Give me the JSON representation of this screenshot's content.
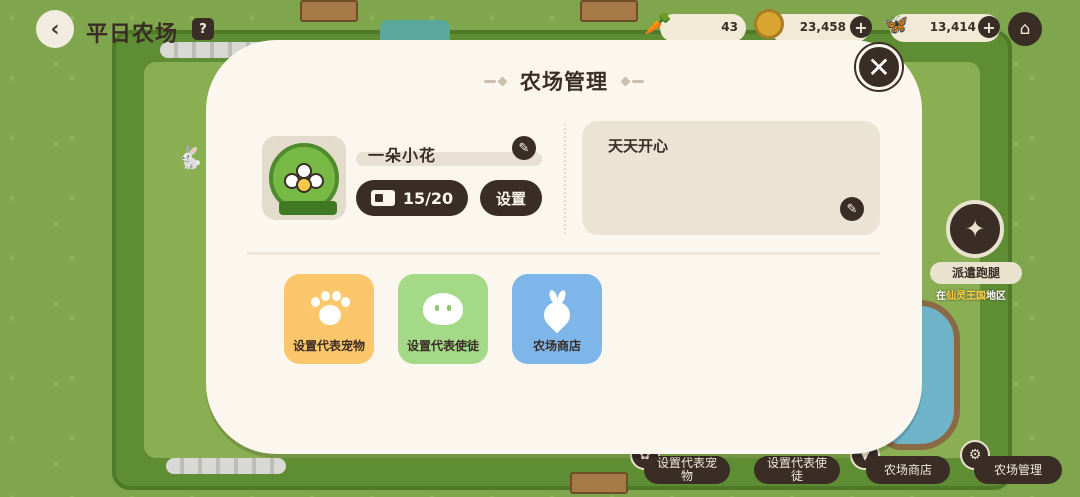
{
  "header": {
    "back_icon": "back-arrow-icon",
    "farm_title": "平日农场",
    "info_icon": "book-icon"
  },
  "resources": [
    {
      "icon": "carrot-icon",
      "value": "43"
    },
    {
      "icon": "coin-icon",
      "value": "23,458"
    },
    {
      "icon": "butterfly-icon",
      "value": "13,414"
    }
  ],
  "dispatch": {
    "label": "派遣跑腿",
    "location_prefix": "在",
    "location_name": "仙灵王国",
    "location_suffix": "地区"
  },
  "dock": {
    "pet": "设置代表宠物",
    "envoy": "设置代表使徒",
    "shop": "农场商店",
    "manage": "农场管理"
  },
  "modal": {
    "title": "农场管理",
    "close_icon": "close-icon",
    "farm_name": "一朵小花",
    "count": "15/20",
    "settings_label": "设置",
    "motto": "天天开心",
    "tiles": [
      {
        "label": "设置代表宠物",
        "color": "#fcc66a",
        "icon": "paw-icon"
      },
      {
        "label": "设置代表使徒",
        "color": "#a3d987",
        "icon": "sprite-icon"
      },
      {
        "label": "农场商店",
        "color": "#7fb6ea",
        "icon": "carrot-icon"
      }
    ]
  },
  "colors": {
    "dark_brown": "#3a2d25",
    "cream": "#fbf6ee",
    "grass": "#7fa64c"
  }
}
